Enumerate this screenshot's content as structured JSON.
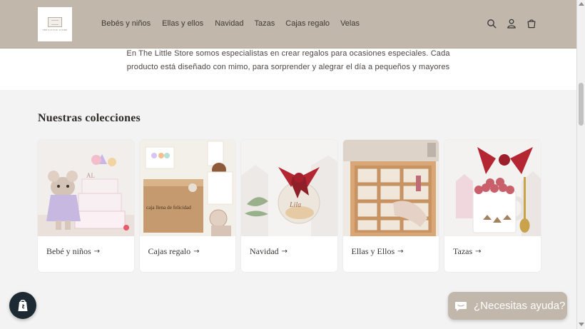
{
  "header": {
    "logo_text": "THE LITTLE STORE",
    "nav": [
      "Bebés y niños",
      "Ellas y ellos",
      "Navidad",
      "Tazas",
      "Cajas regalo",
      "Velas"
    ],
    "icons": [
      "search-icon",
      "account-icon",
      "cart-icon"
    ]
  },
  "intro": {
    "line1": "En The Little Store somos especialistas en crear regalos para ocasiones especiales. Cada",
    "line2": "producto está diseñado con mimo, para sorprender y alegrar el día a pequeños y mayores"
  },
  "collections": {
    "title": "Nuestras colecciones",
    "items": [
      {
        "label": "Bebé y niños"
      },
      {
        "label": "Cajas regalo"
      },
      {
        "label": "Navidad"
      },
      {
        "label": "Ellas y Ellos"
      },
      {
        "label": "Tazas"
      }
    ]
  },
  "box_text": "caja llena de felicidad",
  "chat": {
    "label": "¿Necesitas ayuda?"
  },
  "colors": {
    "header_bg": "#c2b7ab",
    "page_bg": "#f3f3f3",
    "shopify_btn": "#1d2a33"
  }
}
